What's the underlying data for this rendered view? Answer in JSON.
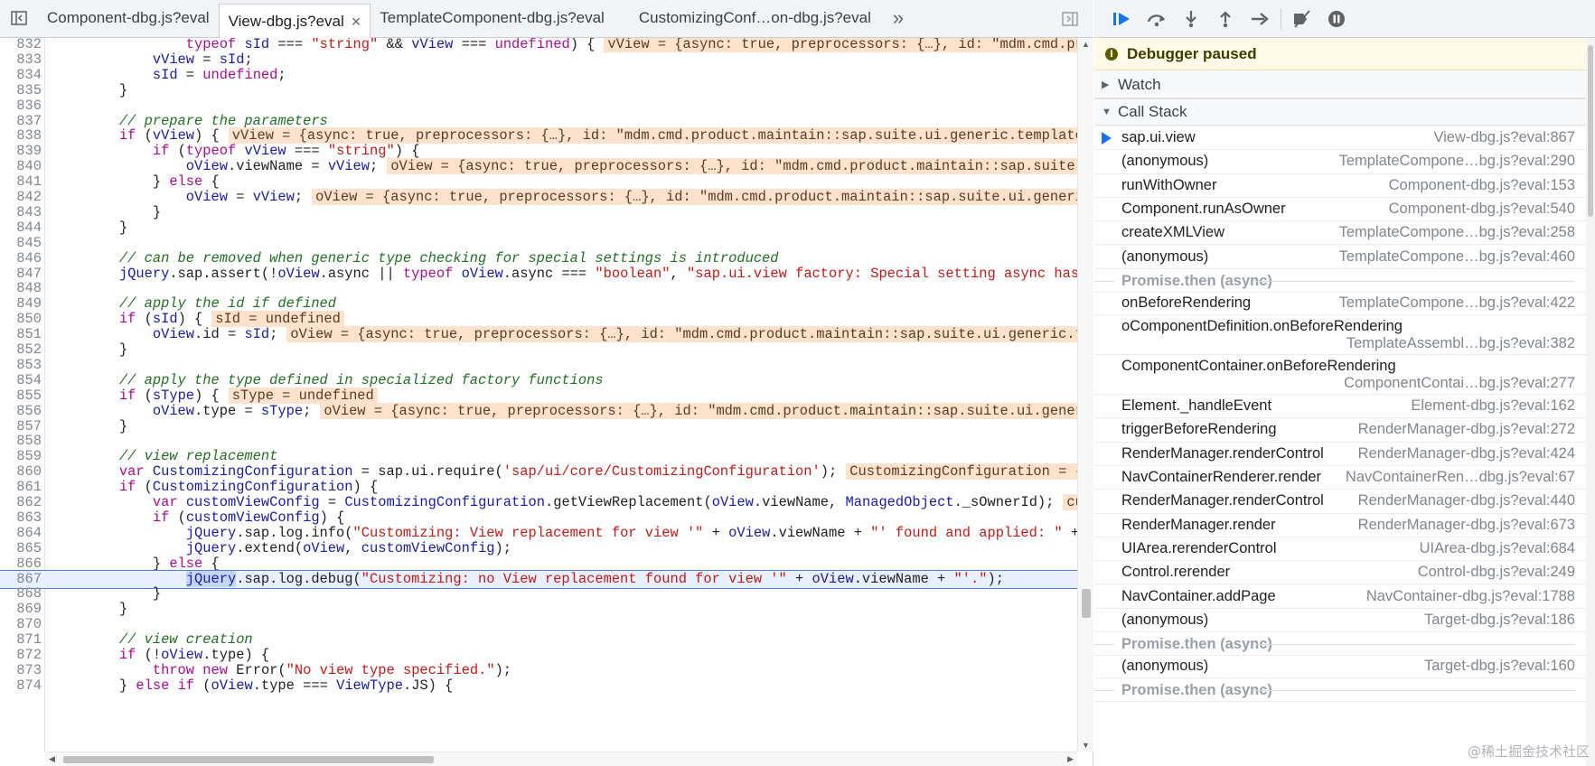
{
  "tabs": [
    {
      "label": "Component-dbg.js?eval",
      "active": false
    },
    {
      "label": "View-dbg.js?eval",
      "active": true
    },
    {
      "label": "TemplateComponent-dbg.js?eval",
      "active": false
    },
    {
      "label": "CustomizingConf…on-dbg.js?eval",
      "active": false
    }
  ],
  "tab_overflow": "»",
  "tab_close": "×",
  "code_lines": [
    {
      "n": "832",
      "html": "                <span class=\"kw\">typeof</span> <span class=\"vr\">sId</span> === <span class=\"str\">\"string\"</span> &amp;&amp; <span class=\"vr\">vView</span> === <span class=\"kw\">undefined</span>) {",
      "inline": "vView = {async: true, preprocessors: {…}, id: \"mdm.cmd.pro"
    },
    {
      "n": "833",
      "html": "            <span class=\"vr\">vView</span> = <span class=\"vr\">sId</span>;"
    },
    {
      "n": "834",
      "html": "            <span class=\"vr\">sId</span> = <span class=\"kw\">undefined</span>;"
    },
    {
      "n": "835",
      "html": "        }"
    },
    {
      "n": "836",
      "html": ""
    },
    {
      "n": "837",
      "html": "        <span class=\"cm\">// prepare the parameters</span>"
    },
    {
      "n": "838",
      "html": "        <span class=\"kw\">if</span> (<span class=\"vr\">vView</span>) {",
      "inline": "vView = {async: true, preprocessors: {…}, id: \"mdm.cmd.product.maintain::sap.suite.ui.generic.template."
    },
    {
      "n": "839",
      "html": "            <span class=\"kw\">if</span> (<span class=\"kw\">typeof</span> <span class=\"vr\">vView</span> === <span class=\"str\">\"string\"</span>) {"
    },
    {
      "n": "840",
      "html": "                <span class=\"vr\">oView</span>.viewName = <span class=\"vr\">vView</span>;",
      "inline": "oView = {async: true, preprocessors: {…}, id: \"mdm.cmd.product.maintain::sap.suite.u"
    },
    {
      "n": "841",
      "html": "            } <span class=\"kw\">else</span> {"
    },
    {
      "n": "842",
      "html": "                <span class=\"vr\">oView</span> = <span class=\"vr\">vView</span>;",
      "inline": "oView = {async: true, preprocessors: {…}, id: \"mdm.cmd.product.maintain::sap.suite.ui.generic"
    },
    {
      "n": "843",
      "html": "            }"
    },
    {
      "n": "844",
      "html": "        }"
    },
    {
      "n": "845",
      "html": ""
    },
    {
      "n": "846",
      "html": "        <span class=\"cm\">// can be removed when generic type checking for special settings is introduced</span>"
    },
    {
      "n": "847",
      "html": "        <span class=\"vr\">jQuery</span>.sap.assert(!<span class=\"vr\">oView</span>.async || <span class=\"kw\">typeof</span> <span class=\"vr\">oView</span>.async === <span class=\"str\">\"boolean\"</span>, <span class=\"str\">\"sap.ui.view factory: Special setting async has to</span>"
    },
    {
      "n": "848",
      "html": ""
    },
    {
      "n": "849",
      "html": "        <span class=\"cm\">// apply the id if defined</span>"
    },
    {
      "n": "850",
      "html": "        <span class=\"kw\">if</span> (<span class=\"vr\">sId</span>) {",
      "inline": "sId = undefined"
    },
    {
      "n": "851",
      "html": "            <span class=\"vr\">oView</span>.id = <span class=\"vr\">sId</span>;",
      "inline": "oView = {async: true, preprocessors: {…}, id: \"mdm.cmd.product.maintain::sap.suite.ui.generic.te"
    },
    {
      "n": "852",
      "html": "        }"
    },
    {
      "n": "853",
      "html": ""
    },
    {
      "n": "854",
      "html": "        <span class=\"cm\">// apply the type defined in specialized factory functions</span>"
    },
    {
      "n": "855",
      "html": "        <span class=\"kw\">if</span> (<span class=\"vr\">sType</span>) {",
      "inline": "sType = undefined"
    },
    {
      "n": "856",
      "html": "            <span class=\"vr\">oView</span>.type = <span class=\"vr\">sType</span>;",
      "inline": "oView = {async: true, preprocessors: {…}, id: \"mdm.cmd.product.maintain::sap.suite.ui.generi"
    },
    {
      "n": "857",
      "html": "        }"
    },
    {
      "n": "858",
      "html": ""
    },
    {
      "n": "859",
      "html": "        <span class=\"cm\">// view replacement</span>"
    },
    {
      "n": "860",
      "html": "        <span class=\"kw\">var</span> <span class=\"vr\">CustomizingConfiguration</span> = sap.ui.require(<span class=\"str\">'sap/ui/core/CustomizingConfiguration'</span>);",
      "inline": "CustomizingConfiguration = {l"
    },
    {
      "n": "861",
      "html": "        <span class=\"kw\">if</span> (<span class=\"vr\">CustomizingConfiguration</span>) {"
    },
    {
      "n": "862",
      "html": "            <span class=\"kw\">var</span> <span class=\"vr\">customViewConfig</span> = <span class=\"vr\">CustomizingConfiguration</span>.getViewReplacement(<span class=\"vr\">oView</span>.viewName, <span class=\"vr\">ManagedObject</span>._sOwnerId);",
      "inline": "cus"
    },
    {
      "n": "863",
      "html": "            <span class=\"kw\">if</span> (<span class=\"vr\">customViewConfig</span>) {"
    },
    {
      "n": "864",
      "html": "                <span class=\"vr\">jQuery</span>.sap.log.info(<span class=\"str\">\"Customizing: View replacement for view '\"</span> + <span class=\"vr\">oView</span>.viewName + <span class=\"str\">\"' found and applied: \"</span> + c"
    },
    {
      "n": "865",
      "html": "                <span class=\"vr\">jQuery</span>.extend(<span class=\"vr\">oView</span>, <span class=\"vr\">customViewConfig</span>);"
    },
    {
      "n": "866",
      "html": "            } <span class=\"kw\">else</span> {"
    },
    {
      "n": "867",
      "html": "                <span class=\"vr hl\">jQuery</span>.sap.log.debug(<span class=\"str\">\"Customizing: no View replacement found for view '\"</span> + <span class=\"vr\">oView</span>.viewName + <span class=\"str\">\"'.\"</span>);",
      "current": true
    },
    {
      "n": "868",
      "html": "            }"
    },
    {
      "n": "869",
      "html": "        }"
    },
    {
      "n": "870",
      "html": ""
    },
    {
      "n": "871",
      "html": "        <span class=\"cm\">// view creation</span>"
    },
    {
      "n": "872",
      "html": "        <span class=\"kw\">if</span> (!<span class=\"vr\">oView</span>.type) {"
    },
    {
      "n": "873",
      "html": "            <span class=\"kw\">throw</span> <span class=\"kw\">new</span> Error(<span class=\"str\">\"No view type specified.\"</span>);"
    },
    {
      "n": "874",
      "html": "        } <span class=\"kw\">else</span> <span class=\"kw\">if</span> (<span class=\"vr\">oView</span>.type === <span class=\"vr\">ViewType</span>.JS) {"
    }
  ],
  "debugger": {
    "paused_text": "Debugger paused",
    "watch_label": "Watch",
    "callstack_label": "Call Stack",
    "toolbar": [
      "resume-icon",
      "step-over-icon",
      "step-into-icon",
      "step-out-icon",
      "step-icon",
      "deactivate-breakpoints-icon",
      "pause-on-exceptions-icon"
    ]
  },
  "call_stack": [
    {
      "name": "sap.ui.view",
      "loc": "View-dbg.js?eval:867",
      "current": true
    },
    {
      "name": "(anonymous)",
      "loc": "TemplateCompone…bg.js?eval:290"
    },
    {
      "name": "runWithOwner",
      "loc": "Component-dbg.js?eval:153"
    },
    {
      "name": "Component.runAsOwner",
      "loc": "Component-dbg.js?eval:540"
    },
    {
      "name": "createXMLView",
      "loc": "TemplateCompone…bg.js?eval:258"
    },
    {
      "name": "(anonymous)",
      "loc": "TemplateCompone…bg.js?eval:460"
    },
    {
      "async": "Promise.then (async)"
    },
    {
      "name": "onBeforeRendering",
      "loc": "TemplateCompone…bg.js?eval:422"
    },
    {
      "name": "oComponentDefinition.onBeforeRendering",
      "loc": "TemplateAssembl…bg.js?eval:382",
      "wrap": true
    },
    {
      "name": "ComponentContainer.onBeforeRendering",
      "loc": "ComponentContai…bg.js?eval:277",
      "wrap": true
    },
    {
      "name": "Element._handleEvent",
      "loc": "Element-dbg.js?eval:162"
    },
    {
      "name": "triggerBeforeRendering",
      "loc": "RenderManager-dbg.js?eval:272"
    },
    {
      "name": "RenderManager.renderControl",
      "loc": "RenderManager-dbg.js?eval:424"
    },
    {
      "name": "NavContainerRenderer.render",
      "loc": "NavContainerRen…dbg.js?eval:67"
    },
    {
      "name": "RenderManager.renderControl",
      "loc": "RenderManager-dbg.js?eval:440"
    },
    {
      "name": "RenderManager.render",
      "loc": "RenderManager-dbg.js?eval:673"
    },
    {
      "name": "UIArea.rerenderControl",
      "loc": "UIArea-dbg.js?eval:684"
    },
    {
      "name": "Control.rerender",
      "loc": "Control-dbg.js?eval:249"
    },
    {
      "name": "NavContainer.addPage",
      "loc": "NavContainer-dbg.js?eval:1788"
    },
    {
      "name": "(anonymous)",
      "loc": "Target-dbg.js?eval:186"
    },
    {
      "async": "Promise.then (async)"
    },
    {
      "name": "(anonymous)",
      "loc": "Target-dbg.js?eval:160"
    },
    {
      "async": "Promise.then (async)"
    }
  ],
  "watermark": "@稀土掘金技术社区"
}
